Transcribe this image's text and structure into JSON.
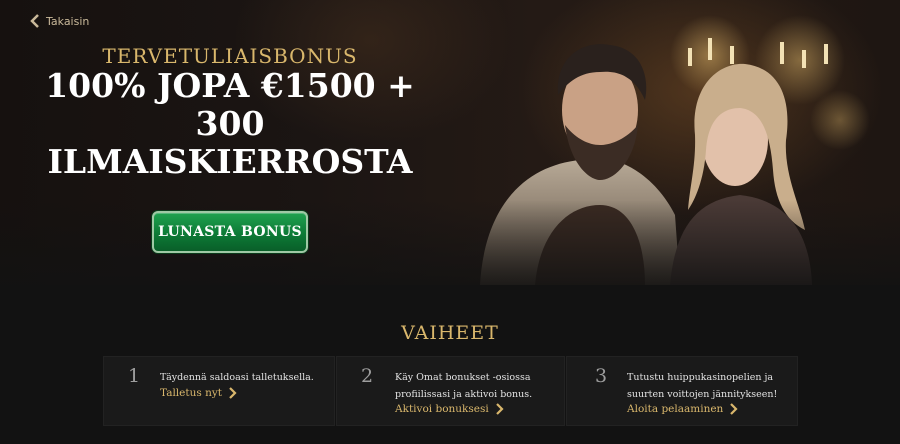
{
  "nav": {
    "back_label": "Takaisin"
  },
  "hero": {
    "eyebrow": "TERVETULIAISBONUS",
    "title_line1": "100% JOPA €1500 +",
    "title_line2": "300",
    "title_line3": "ILMAISKIERROSTA",
    "cta_label": "LUNASTA BONUS"
  },
  "steps": {
    "title": "VAIHEET",
    "items": [
      {
        "number": "1",
        "text": "Täydennä saldoasi talletuksella.",
        "link": "Talletus nyt"
      },
      {
        "number": "2",
        "text": "Käy Omat bonukset -osiossa profiilissasi ja aktivoi bonus.",
        "link": "Aktivoi bonuksesi"
      },
      {
        "number": "3",
        "text": "Tutustu huippukasinopelien ja suurten voittojen jännitykseen!",
        "link": "Aloita pelaaminen"
      }
    ]
  },
  "colors": {
    "accent_gold": "#d9b76c",
    "cta_green": "#0d7a36",
    "background": "#121212"
  },
  "icons": {
    "back": "chevron-left-icon",
    "step_link": "chevron-right-icon"
  }
}
